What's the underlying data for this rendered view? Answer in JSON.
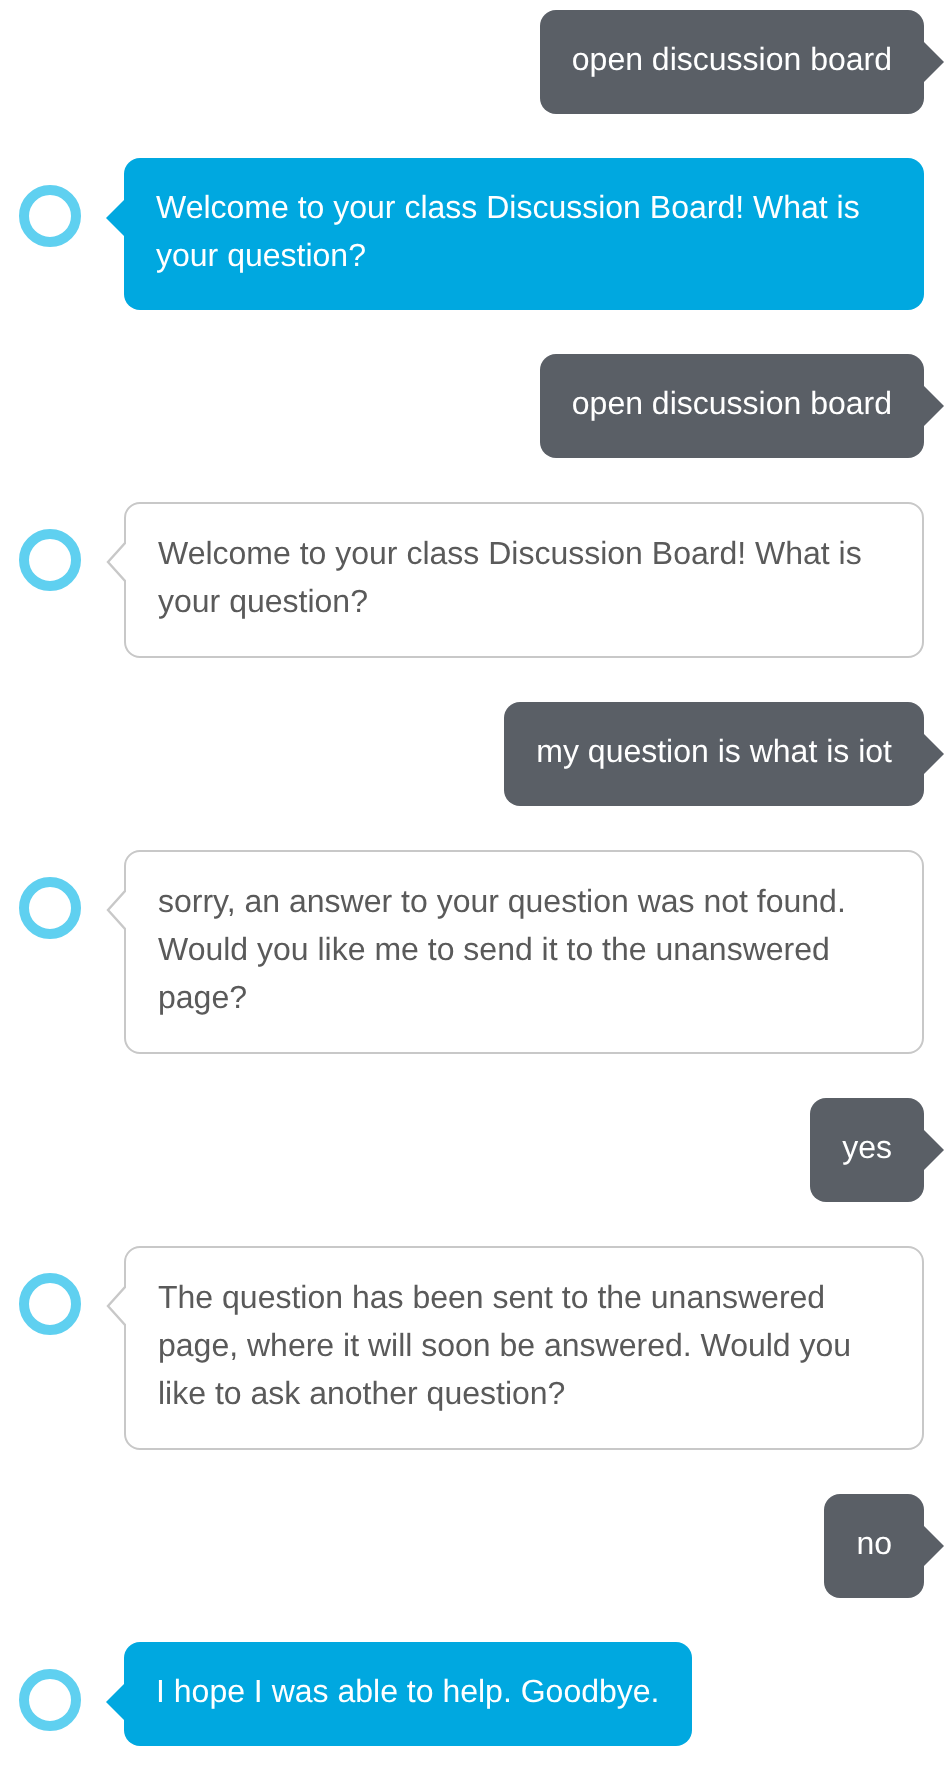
{
  "messages": [
    {
      "kind": "user",
      "text": "open discussion board"
    },
    {
      "kind": "assistant",
      "highlighted": true,
      "text": "Welcome to your class Discussion Board! What is your question?"
    },
    {
      "kind": "user",
      "text": "open discussion board"
    },
    {
      "kind": "assistant",
      "highlighted": false,
      "text": "Welcome to your class Discussion Board! What is your question?"
    },
    {
      "kind": "user",
      "text": "my question is what is iot"
    },
    {
      "kind": "assistant",
      "highlighted": false,
      "text": "sorry, an answer to your question was not found. Would you like me to send it to the unanswered page?"
    },
    {
      "kind": "user",
      "text": "yes"
    },
    {
      "kind": "assistant",
      "highlighted": false,
      "text": "The question has been sent to the unanswered page, where it will soon be answered. Would you like to ask another question?"
    },
    {
      "kind": "user",
      "text": "no"
    },
    {
      "kind": "assistant",
      "highlighted": true,
      "text": "I hope I was able to help. Goodbye."
    }
  ]
}
